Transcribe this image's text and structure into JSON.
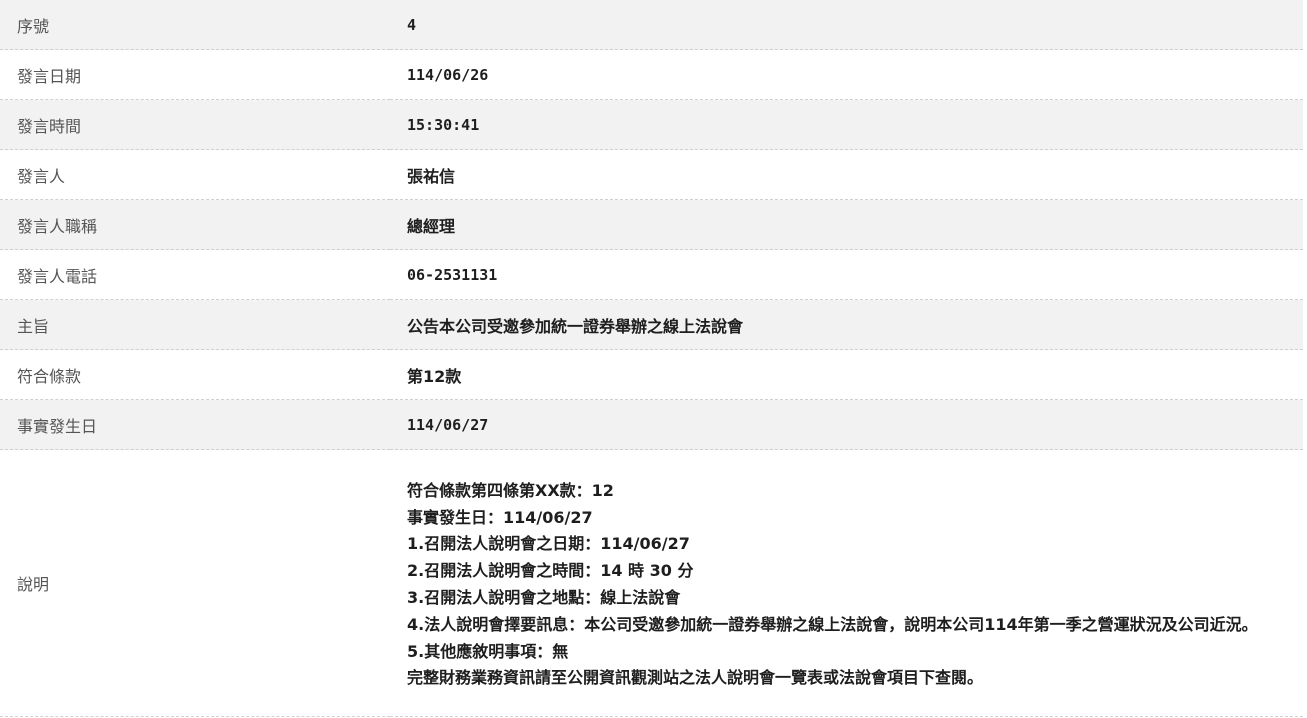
{
  "rows": [
    {
      "label": "序號",
      "value": "4"
    },
    {
      "label": "發言日期",
      "value": "114/06/26"
    },
    {
      "label": "發言時間",
      "value": "15:30:41"
    },
    {
      "label": "發言人",
      "value": "張祐信"
    },
    {
      "label": "發言人職稱",
      "value": "總經理"
    },
    {
      "label": "發言人電話",
      "value": "06-2531131"
    },
    {
      "label": "主旨",
      "value": "公告本公司受邀參加統一證券舉辦之線上法說會"
    },
    {
      "label": "符合條款",
      "value": "第12款"
    },
    {
      "label": "事實發生日",
      "value": "114/06/27"
    }
  ],
  "description": {
    "label": "說明",
    "lines": [
      "符合條款第四條第XX款：12",
      "事實發生日：114/06/27",
      "1.召開法人說明會之日期：114/06/27",
      "2.召開法人說明會之時間：14 時 30 分",
      "3.召開法人說明會之地點：線上法說會",
      "4.法人說明會擇要訊息：本公司受邀參加統一證券舉辦之線上法說會，說明本公司114年第一季之營運狀況及公司近況。",
      "5.其他應敘明事項：無",
      "完整財務業務資訊請至公開資訊觀測站之法人說明會一覽表或法說會項目下查閱。"
    ]
  }
}
